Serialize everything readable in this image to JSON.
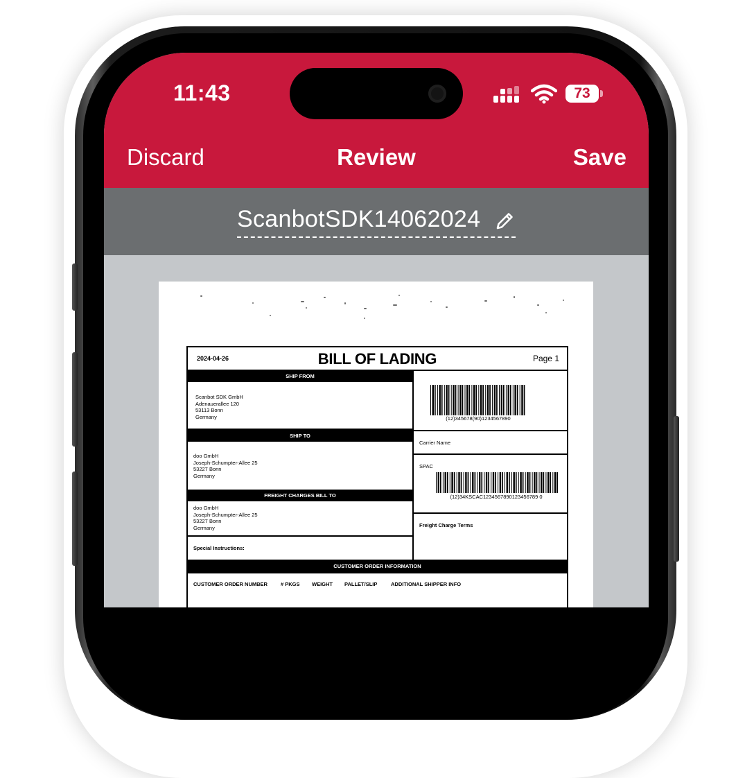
{
  "status_bar": {
    "time": "11:43",
    "battery": "73",
    "icons": [
      "cellular-signal-icon",
      "wifi-icon",
      "battery-icon"
    ]
  },
  "nav_bar": {
    "discard_label": "Discard",
    "title": "Review",
    "save_label": "Save",
    "background_color": "#c8183c"
  },
  "document_header": {
    "name": "ScanbotSDK14062024",
    "edit_icon": "pencil-icon",
    "background_color": "#6b6e70"
  },
  "scanned_document": {
    "date": "2024-04-26",
    "title": "BILL OF LADING",
    "page": "Page 1",
    "ship_from": {
      "heading": "SHIP FROM",
      "lines": [
        "Scanbot SDK GmbH",
        "Adenauerallee 120",
        "53113 Bonn",
        "Germany"
      ]
    },
    "ship_to": {
      "heading": "SHIP TO",
      "lines": [
        "doo GmbH",
        "Joseph-Schumpter-Allee 25",
        "53227 Bonn",
        "Germany"
      ]
    },
    "freight_bill_to": {
      "heading": "FREIGHT CHARGES BILL TO",
      "lines": [
        "doo GmbH",
        "Joseph-Schumpter-Allee 25",
        "53227 Bonn",
        "Germany"
      ]
    },
    "special_instructions_label": "Special Instructions:",
    "barcode_1_text": "(12)345678(90)1234567890",
    "carrier_name_label": "Carrier Name",
    "spac_label": "SPAC",
    "barcode_2_text": "(12)34KSCAC1234567890123456789 0",
    "freight_terms_label": "Freight Charge Terms",
    "customer_order_heading": "CUSTOMER ORDER INFORMATION",
    "columns": [
      "CUSTOMER ORDER NUMBER",
      "# PKGS",
      "WEIGHT",
      "PALLET/SLIP",
      "ADDITIONAL SHIPPER INFO"
    ]
  }
}
